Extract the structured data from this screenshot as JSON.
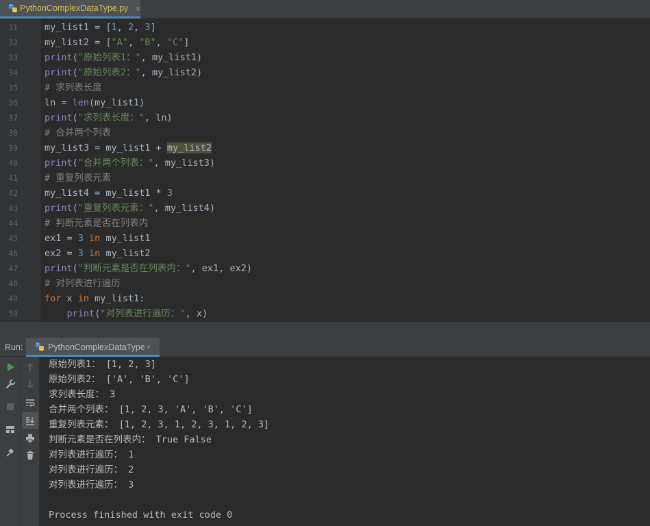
{
  "tab": {
    "file_name": "PythonComplexDataType.py",
    "close": "×"
  },
  "editor": {
    "lines": [
      {
        "num": "31",
        "tokens": [
          [
            "t",
            "my_list1 = ["
          ],
          [
            "n",
            "1"
          ],
          [
            "t",
            ", "
          ],
          [
            "n",
            "2"
          ],
          [
            "t",
            ", "
          ],
          [
            "n",
            "3"
          ],
          [
            "t",
            "]"
          ]
        ]
      },
      {
        "num": "32",
        "tokens": [
          [
            "t",
            "my_list2 = ["
          ],
          [
            "s",
            "\"A\""
          ],
          [
            "t",
            ", "
          ],
          [
            "s",
            "\"B\""
          ],
          [
            "t",
            ", "
          ],
          [
            "s",
            "\"C\""
          ],
          [
            "t",
            "]"
          ]
        ]
      },
      {
        "num": "33",
        "tokens": [
          [
            "b",
            "print"
          ],
          [
            "t",
            "("
          ],
          [
            "s",
            "\"原始列表1：\""
          ],
          [
            "t",
            ", my_list1)"
          ]
        ]
      },
      {
        "num": "34",
        "tokens": [
          [
            "b",
            "print"
          ],
          [
            "t",
            "("
          ],
          [
            "s",
            "\"原始列表2：\""
          ],
          [
            "t",
            ", my_list2)"
          ]
        ]
      },
      {
        "num": "35",
        "tokens": [
          [
            "c",
            "# 求列表长度"
          ]
        ]
      },
      {
        "num": "36",
        "tokens": [
          [
            "t",
            "ln = "
          ],
          [
            "b",
            "len"
          ],
          [
            "t",
            "(my_list1)"
          ]
        ]
      },
      {
        "num": "37",
        "tokens": [
          [
            "b",
            "print"
          ],
          [
            "t",
            "("
          ],
          [
            "s",
            "\"求列表长度：\""
          ],
          [
            "t",
            ", ln)"
          ]
        ]
      },
      {
        "num": "38",
        "tokens": [
          [
            "c",
            "# 合并两个列表"
          ]
        ]
      },
      {
        "num": "39",
        "tokens": [
          [
            "t",
            "my_list3 = my_list1 + "
          ],
          [
            "h",
            "my_list2"
          ]
        ]
      },
      {
        "num": "40",
        "tokens": [
          [
            "b",
            "print"
          ],
          [
            "t",
            "("
          ],
          [
            "s",
            "\"合并两个列表：\""
          ],
          [
            "t",
            ", my_list3)"
          ]
        ]
      },
      {
        "num": "41",
        "tokens": [
          [
            "c",
            "# 重复列表元素"
          ]
        ]
      },
      {
        "num": "42",
        "tokens": [
          [
            "t",
            "my_list4 = my_list1 * "
          ],
          [
            "n",
            "3"
          ]
        ]
      },
      {
        "num": "43",
        "tokens": [
          [
            "b",
            "print"
          ],
          [
            "t",
            "("
          ],
          [
            "s",
            "\"重复列表元素：\""
          ],
          [
            "t",
            ", my_list4)"
          ]
        ]
      },
      {
        "num": "44",
        "tokens": [
          [
            "c",
            "# 判断元素是否在列表内"
          ]
        ]
      },
      {
        "num": "45",
        "tokens": [
          [
            "t",
            "ex1 = "
          ],
          [
            "n",
            "3"
          ],
          [
            "k",
            " in"
          ],
          [
            "t",
            " my_list1"
          ]
        ]
      },
      {
        "num": "46",
        "tokens": [
          [
            "t",
            "ex2 = "
          ],
          [
            "n",
            "3"
          ],
          [
            "k",
            " in"
          ],
          [
            "t",
            " my_list2"
          ]
        ]
      },
      {
        "num": "47",
        "tokens": [
          [
            "b",
            "print"
          ],
          [
            "t",
            "("
          ],
          [
            "s",
            "\"判断元素是否在列表内：\""
          ],
          [
            "t",
            ", ex1, ex2)"
          ]
        ]
      },
      {
        "num": "48",
        "tokens": [
          [
            "c",
            "# 对列表进行遍历"
          ]
        ]
      },
      {
        "num": "49",
        "tokens": [
          [
            "k",
            "for"
          ],
          [
            "t",
            " x "
          ],
          [
            "k",
            "in"
          ],
          [
            "t",
            " my_list1:"
          ]
        ]
      },
      {
        "num": "50",
        "tokens": [
          [
            "t",
            "    "
          ],
          [
            "b",
            "print"
          ],
          [
            "t",
            "("
          ],
          [
            "s",
            "\"对列表进行遍历：\""
          ],
          [
            "t",
            ", x)"
          ]
        ]
      }
    ]
  },
  "run_panel": {
    "label": "Run:",
    "tab_name": "PythonComplexDataType",
    "close": "×",
    "output": [
      "原始列表1： [1, 2, 3]",
      "原始列表2： ['A', 'B', 'C']",
      "求列表长度： 3",
      "合并两个列表： [1, 2, 3, 'A', 'B', 'C']",
      "重复列表元素： [1, 2, 3, 1, 2, 3, 1, 2, 3]",
      "判断元素是否在列表内： True False",
      "对列表进行遍历： 1",
      "对列表进行遍历： 2",
      "对列表进行遍历： 3",
      "",
      "Process finished with exit code 0"
    ]
  },
  "toolbar_icons": [
    "run-icon",
    "wrench-icon",
    "stop-icon",
    "layout-icon",
    "pin-icon",
    "up-arrow-icon",
    "down-arrow-icon",
    "soft-wrap-icon",
    "scroll-to-end-icon",
    "print-icon",
    "trash-icon"
  ]
}
